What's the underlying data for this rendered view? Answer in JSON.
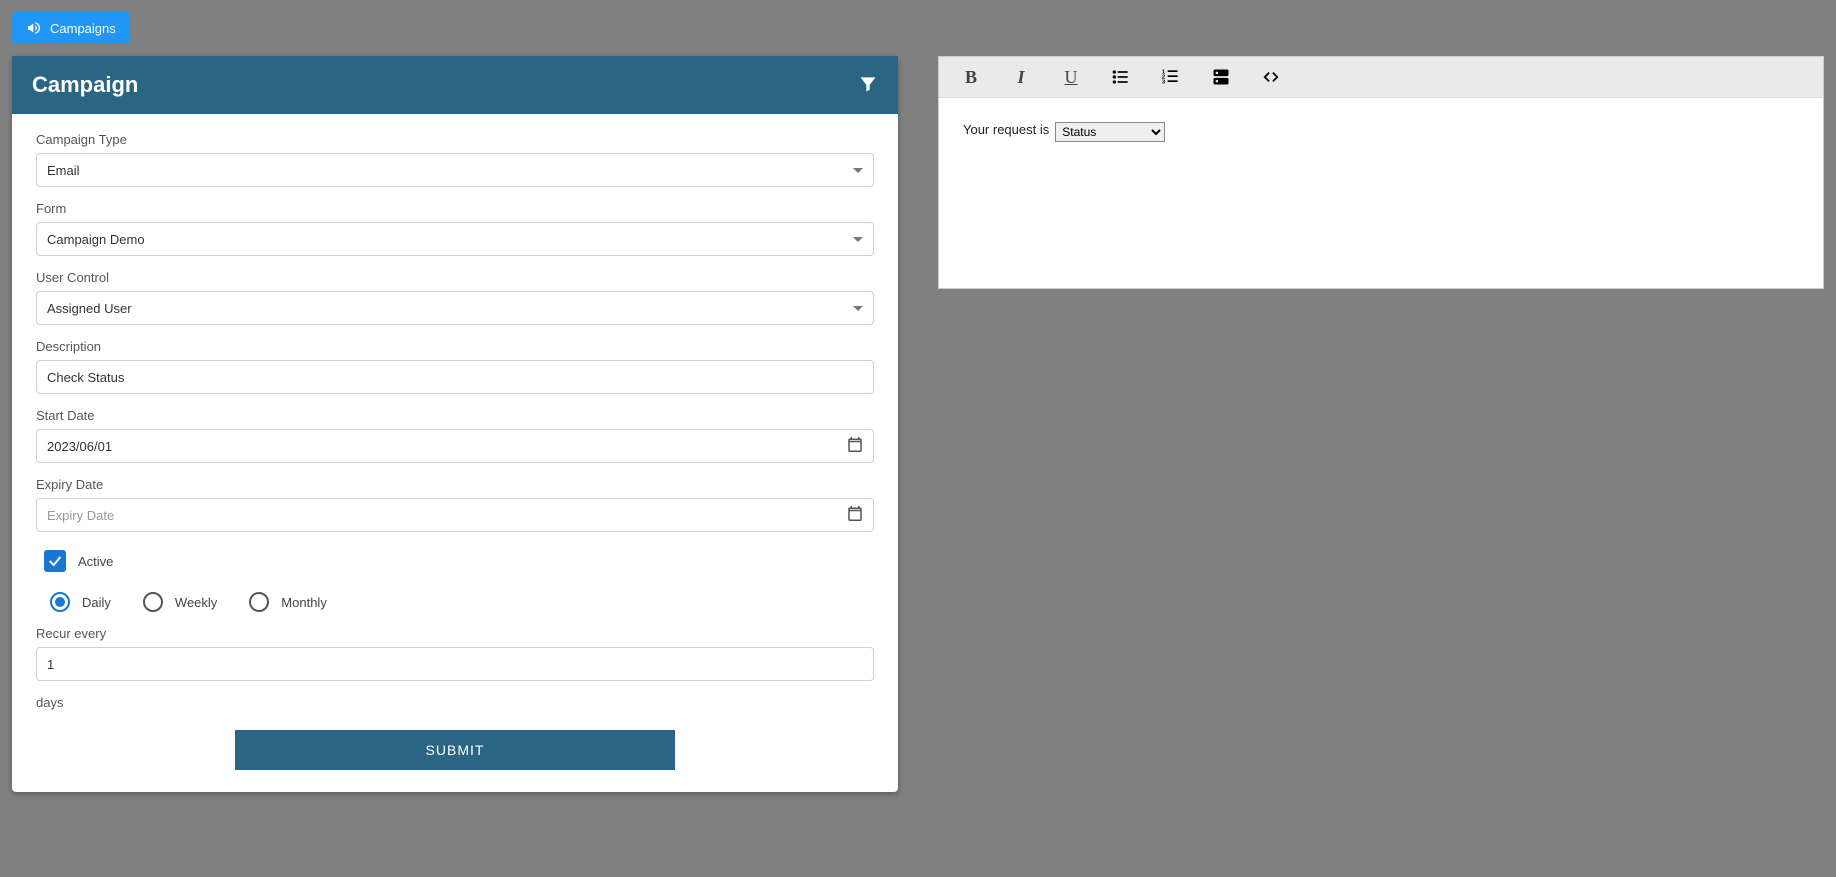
{
  "top_button": {
    "label": "Campaigns"
  },
  "card": {
    "title": "Campaign",
    "fields": {
      "campaign_type": {
        "label": "Campaign Type",
        "value": "Email"
      },
      "form": {
        "label": "Form",
        "value": "Campaign Demo"
      },
      "user_control": {
        "label": "User Control",
        "value": "Assigned User"
      },
      "description": {
        "label": "Description",
        "value": "Check Status"
      },
      "start_date": {
        "label": "Start Date",
        "value": "2023/06/01"
      },
      "expiry_date": {
        "label": "Expiry Date",
        "value": "",
        "placeholder": "Expiry Date"
      },
      "active": {
        "label": "Active",
        "checked": true
      },
      "frequency": {
        "options": [
          "Daily",
          "Weekly",
          "Monthly"
        ],
        "selected": "Daily"
      },
      "recur_every": {
        "label": "Recur every",
        "value": "1"
      },
      "recur_unit": "days"
    },
    "submit_label": "SUBMIT"
  },
  "editor": {
    "prefix_text": "Your request is",
    "select_value": "Status"
  }
}
